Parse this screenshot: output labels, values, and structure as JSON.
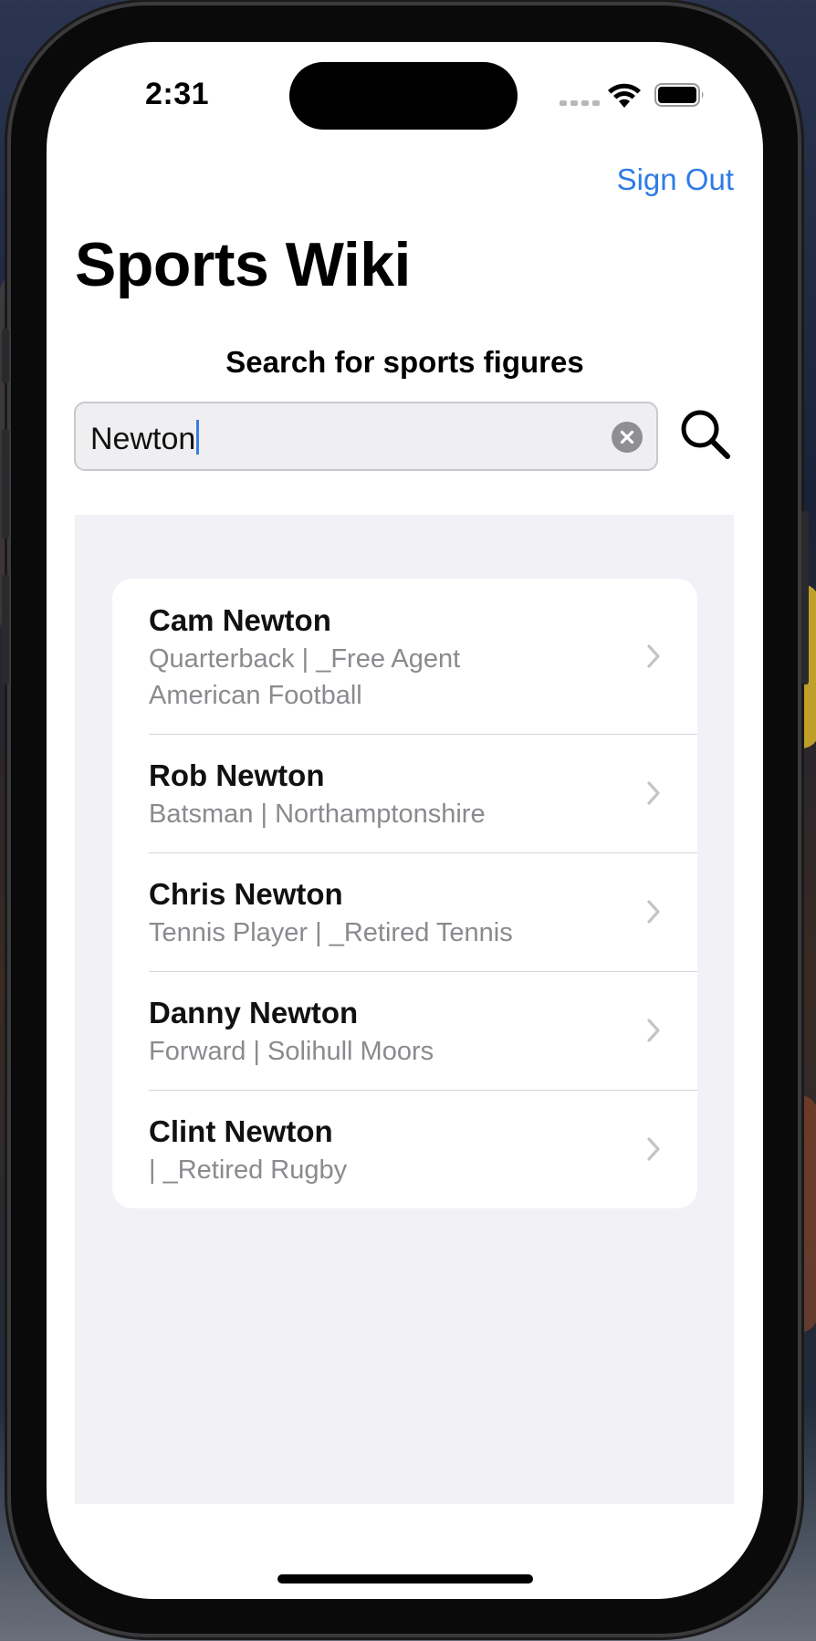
{
  "status_bar": {
    "time": "2:31",
    "wifi_icon": "wifi-icon",
    "battery_icon": "battery-icon",
    "signal_icon": "signal-dots-icon"
  },
  "nav": {
    "sign_out_label": "Sign Out"
  },
  "page": {
    "title": "Sports Wiki",
    "search_caption": "Search for sports figures"
  },
  "search": {
    "value": "Newton",
    "clear_icon": "clear-circle-icon",
    "search_icon": "magnifying-glass-icon"
  },
  "results": [
    {
      "name": "Cam Newton",
      "subtitle": "Quarterback | _Free Agent",
      "subtitle2": "American Football"
    },
    {
      "name": "Rob Newton",
      "subtitle": "Batsman | Northamptonshire",
      "subtitle2": null
    },
    {
      "name": "Chris Newton",
      "subtitle": "Tennis Player | _Retired Tennis",
      "subtitle2": null
    },
    {
      "name": "Danny Newton",
      "subtitle": "Forward | Solihull Moors",
      "subtitle2": null
    },
    {
      "name": "Clint Newton",
      "subtitle": " | _Retired Rugby",
      "subtitle2": null
    }
  ],
  "colors": {
    "accent": "#2f7ce5",
    "panel_background": "#f1f1f6",
    "secondary_text": "#8a8a8f"
  }
}
